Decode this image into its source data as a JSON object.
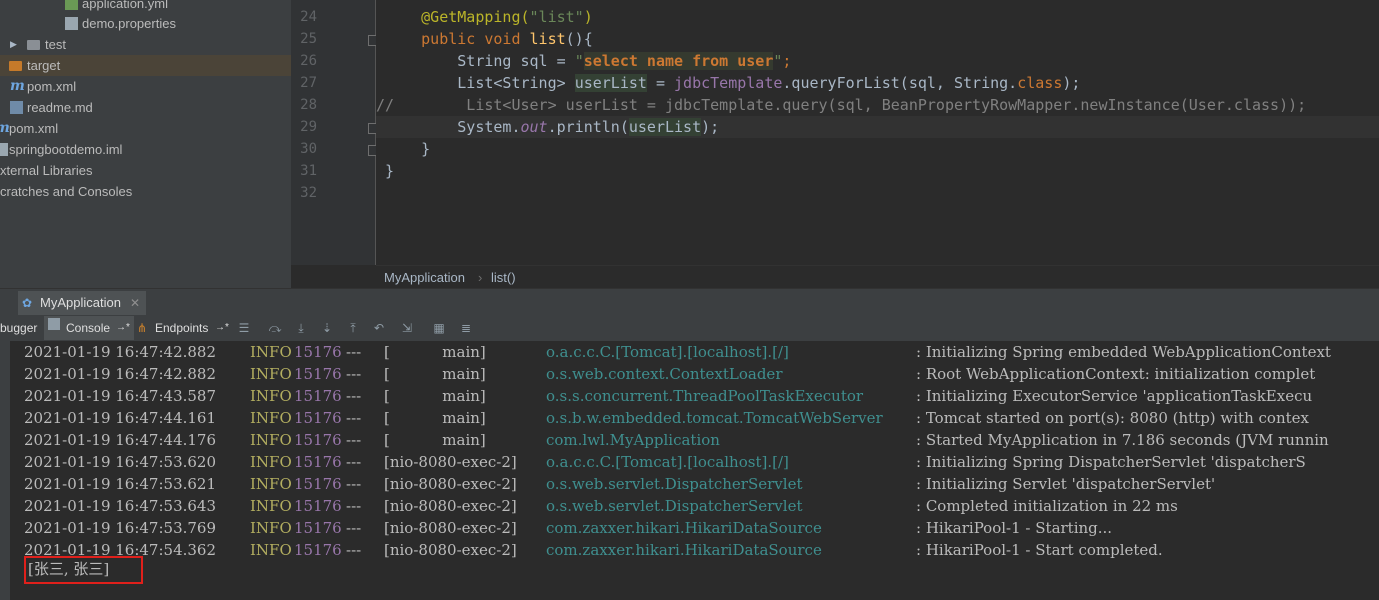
{
  "project_tree": {
    "items": [
      {
        "label": "application.yml",
        "icon": "yml-file-icon"
      },
      {
        "label": "demo.properties",
        "icon": "properties-file-icon"
      },
      {
        "label": "test",
        "icon": "folder-icon"
      },
      {
        "label": "target",
        "icon": "folder-icon"
      },
      {
        "label": "pom.xml",
        "icon": "maven-icon"
      },
      {
        "label": "readme.md",
        "icon": "markdown-file-icon"
      },
      {
        "label": "pom.xml",
        "icon": "xml-file-icon"
      },
      {
        "label": "springbootdemo.iml",
        "icon": "iml-file-icon"
      },
      {
        "label": "xternal Libraries",
        "icon": "library-icon"
      },
      {
        "label": "cratches and Consoles",
        "icon": "scratch-icon"
      }
    ]
  },
  "editor": {
    "line_numbers": [
      "24",
      "25",
      "26",
      "27",
      "28",
      "29",
      "30",
      "31",
      "32"
    ],
    "lines": [
      {
        "ann": "@GetMapping(",
        "str": "\"list\"",
        "rest": ")"
      },
      {
        "kw1": "public void ",
        "name": "list",
        "rest": "(){"
      },
      {
        "a": "String sql = ",
        "q1": "\"",
        "sql": "select name from user",
        "q2": "\"",
        "semi": ";"
      },
      {
        "a": "List<String> ",
        "var": "userList",
        "b": " = ",
        "fld": "jdbcTemplate",
        "c": ".queryForList(sql, String.",
        "kw": "class",
        "d": ");"
      },
      {
        "comment": "//        List<User> userList = jdbcTemplate.query(sql, BeanPropertyRowMapper.newInstance(User.class));"
      },
      {
        "a": "System.",
        "out": "out",
        "b": ".println(",
        "var": "userList",
        "c": ");"
      },
      {
        "text": "}"
      },
      {
        "text": "}"
      },
      {
        "text": ""
      }
    ]
  },
  "breadcrumb": {
    "items": [
      "MyApplication",
      "list()"
    ],
    "separator": "›"
  },
  "run_panel": {
    "tab_label": "MyApplication",
    "toolbar": {
      "debugger": "bugger",
      "console": "Console",
      "endpoints": "Endpoints"
    },
    "logs": [
      {
        "ts": "2021-01-19 16:47:42.882",
        "level": "INFO",
        "pid": "15176",
        "sep": "---",
        "thread": "[           main]",
        "logger": "o.a.c.c.C.[Tomcat].[localhost].[/]",
        "msg": ": Initializing Spring embedded WebApplicationContext"
      },
      {
        "ts": "2021-01-19 16:47:42.882",
        "level": "INFO",
        "pid": "15176",
        "sep": "---",
        "thread": "[           main]",
        "logger": "o.s.web.context.ContextLoader",
        "msg": ": Root WebApplicationContext: initialization complet"
      },
      {
        "ts": "2021-01-19 16:47:43.587",
        "level": "INFO",
        "pid": "15176",
        "sep": "---",
        "thread": "[           main]",
        "logger": "o.s.s.concurrent.ThreadPoolTaskExecutor",
        "msg": ": Initializing ExecutorService 'applicationTaskExecu"
      },
      {
        "ts": "2021-01-19 16:47:44.161",
        "level": "INFO",
        "pid": "15176",
        "sep": "---",
        "thread": "[           main]",
        "logger": "o.s.b.w.embedded.tomcat.TomcatWebServer",
        "msg": ": Tomcat started on port(s): 8080 (http) with contex"
      },
      {
        "ts": "2021-01-19 16:47:44.176",
        "level": "INFO",
        "pid": "15176",
        "sep": "---",
        "thread": "[           main]",
        "logger": "com.lwl.MyApplication",
        "msg": ": Started MyApplication in 7.186 seconds (JVM runnin"
      },
      {
        "ts": "2021-01-19 16:47:53.620",
        "level": "INFO",
        "pid": "15176",
        "sep": "---",
        "thread": "[nio-8080-exec-2]",
        "logger": "o.a.c.c.C.[Tomcat].[localhost].[/]",
        "msg": ": Initializing Spring DispatcherServlet 'dispatcherS"
      },
      {
        "ts": "2021-01-19 16:47:53.621",
        "level": "INFO",
        "pid": "15176",
        "sep": "---",
        "thread": "[nio-8080-exec-2]",
        "logger": "o.s.web.servlet.DispatcherServlet",
        "msg": ": Initializing Servlet 'dispatcherServlet'"
      },
      {
        "ts": "2021-01-19 16:47:53.643",
        "level": "INFO",
        "pid": "15176",
        "sep": "---",
        "thread": "[nio-8080-exec-2]",
        "logger": "o.s.web.servlet.DispatcherServlet",
        "msg": ": Completed initialization in 22 ms"
      },
      {
        "ts": "2021-01-19 16:47:53.769",
        "level": "INFO",
        "pid": "15176",
        "sep": "---",
        "thread": "[nio-8080-exec-2]",
        "logger": "com.zaxxer.hikari.HikariDataSource",
        "msg": ": HikariPool-1 - Starting..."
      },
      {
        "ts": "2021-01-19 16:47:54.362",
        "level": "INFO",
        "pid": "15176",
        "sep": "---",
        "thread": "[nio-8080-exec-2]",
        "logger": "com.zaxxer.hikari.HikariDataSource",
        "msg": ": HikariPool-1 - Start completed."
      }
    ],
    "output": "[张三, 张三]"
  },
  "colors": {
    "accent_highlight": "#e0201b",
    "keyword": "#cc7832",
    "string": "#6a8759",
    "annotation": "#bbb529"
  }
}
